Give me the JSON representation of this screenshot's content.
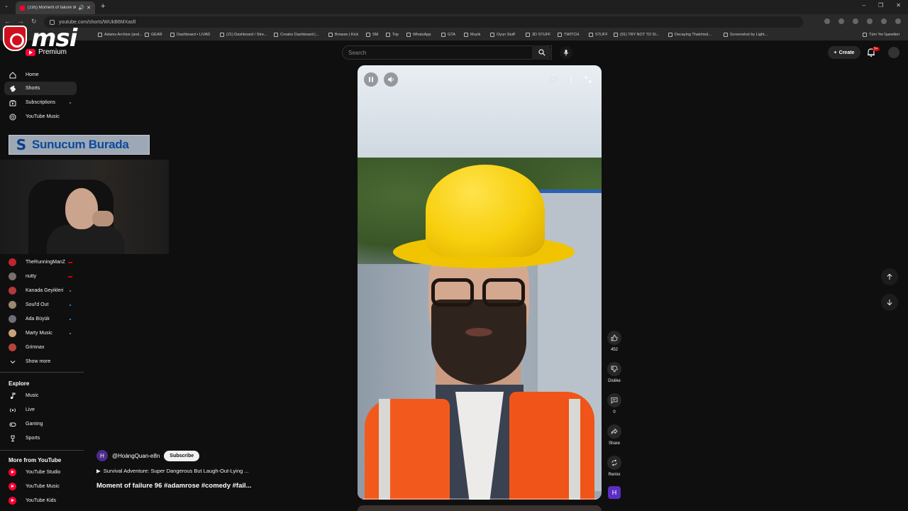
{
  "browser": {
    "tab_title": "(195) Moment of failure 96",
    "url": "youtube.com/shorts/WUkB6MXasfI",
    "bookmarks": [
      "Adams Archive (and...",
      "GEAR",
      "Dashboard • LIVAD",
      "(21) Dashboard / Stre...",
      "Creator Dashboard |...",
      "Browse | Kick",
      "SM",
      "Top",
      "WhatsApp",
      "GTA",
      "Muzik",
      "Oyun Stuff",
      "3D STUFF",
      "TWITCH",
      "STUFF",
      "(91) TRY NOT TO SI...",
      "Decaying Thatched...",
      "Screenshot by Light...",
      "Tüm Yer İşaretleri"
    ]
  },
  "overlay": {
    "logo_text": "msi",
    "banner_text": "Sunucum Burada",
    "banner_logo": "S"
  },
  "header": {
    "brand": "Premium",
    "search_placeholder": "Search",
    "create_label": "Create",
    "notif_badge": "9+"
  },
  "sidebar": {
    "main": [
      {
        "label": "Home",
        "icon": "home-icon"
      },
      {
        "label": "Shorts",
        "icon": "shorts-icon"
      },
      {
        "label": "Subscriptions",
        "icon": "subscriptions-icon"
      },
      {
        "label": "YouTube Music",
        "icon": "music-circle-icon"
      }
    ],
    "channels": [
      {
        "label": "TheRunningManZ",
        "color": "#c0242e"
      },
      {
        "label": "nutty",
        "color": "#7a6f6a"
      },
      {
        "label": "Kanada Geyikleri",
        "color": "#b23a3a"
      },
      {
        "label": "Soul'd Out",
        "color": "#9a8a70"
      },
      {
        "label": "Ada Büyük",
        "color": "#6b6f7a"
      },
      {
        "label": "Marty Music",
        "color": "#c9a27a"
      },
      {
        "label": "Grimnax",
        "color": "#b8433a"
      }
    ],
    "show_more": "Show more",
    "explore_heading": "Explore",
    "explore": [
      {
        "label": "Music",
        "icon": "music-note-icon"
      },
      {
        "label": "Live",
        "icon": "live-icon"
      },
      {
        "label": "Gaming",
        "icon": "gaming-icon"
      },
      {
        "label": "Sports",
        "icon": "trophy-icon"
      }
    ],
    "more_heading": "More from YouTube",
    "more": [
      {
        "label": "YouTube Studio"
      },
      {
        "label": "YouTube Music"
      },
      {
        "label": "YouTube Kids"
      }
    ]
  },
  "short": {
    "channel": "@HoàngQuan-e8n",
    "channel_initial": "H",
    "subscribe": "Subscribe",
    "related": "Survival Adventure: Super Dangerous But Laugh-Out-Lying ...",
    "title": "Moment of failure 96 #adamrose #comedy #fail...",
    "progress": 0.02
  },
  "actions": {
    "likes": "452",
    "dislike": "Dislike",
    "comments": "0",
    "share": "Share",
    "remix": "Remix",
    "avatar": "H"
  }
}
